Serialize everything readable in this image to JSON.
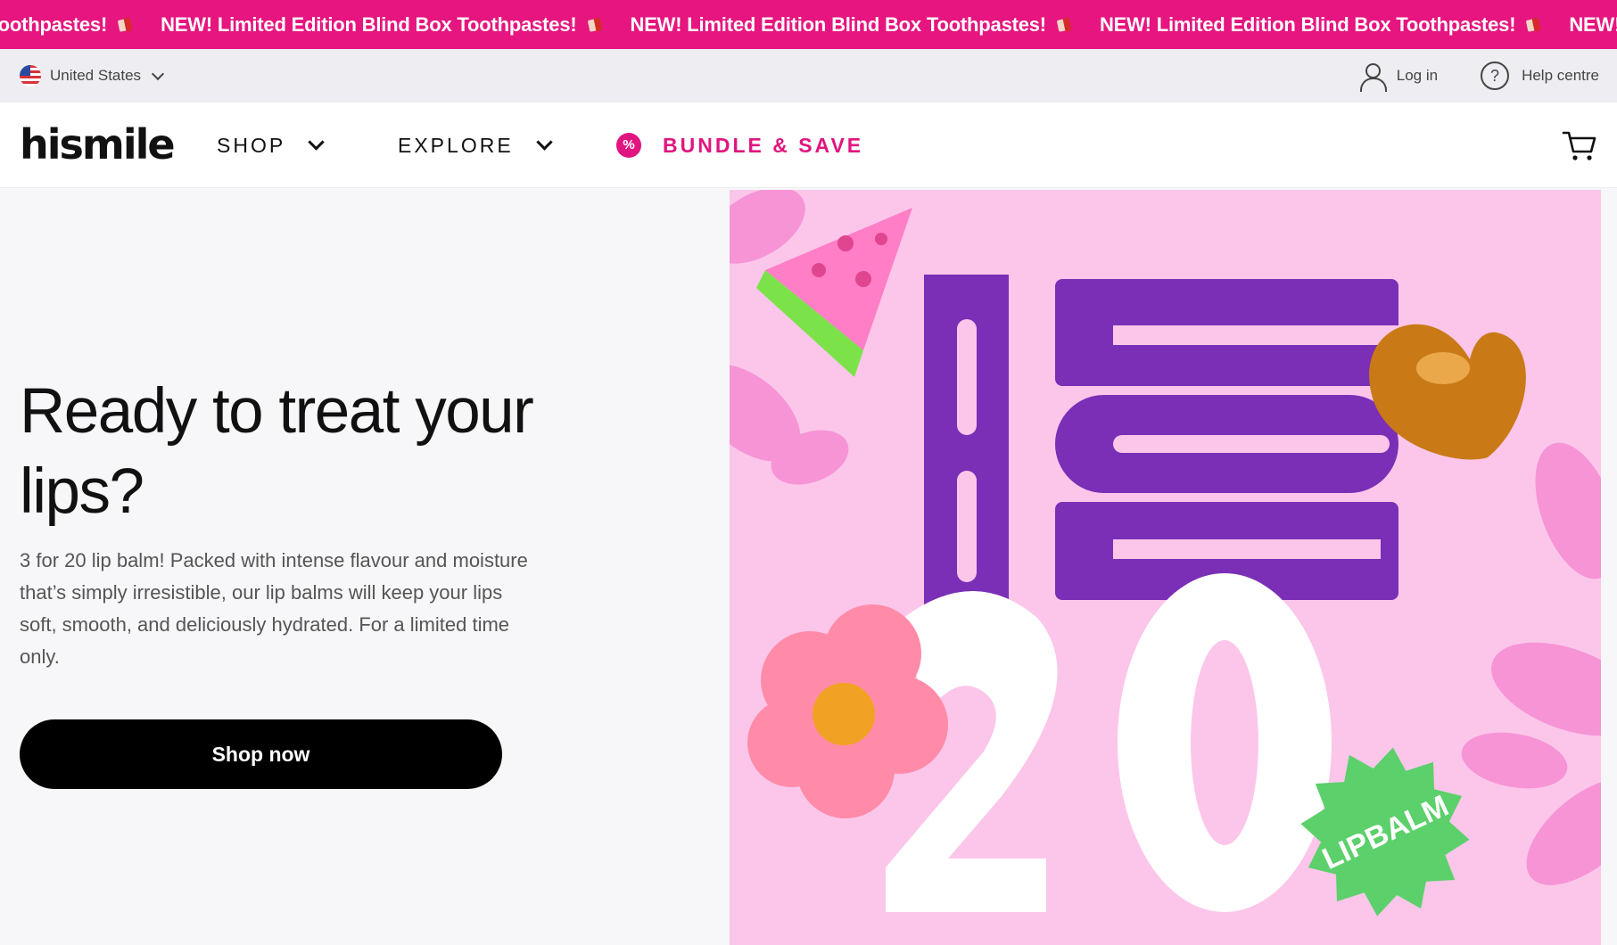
{
  "announcement": {
    "items": [
      "Toothpastes!",
      "NEW! Limited Edition Blind Box Toothpastes!",
      "NEW! Limited Edition Blind Box Toothpastes!",
      "NEW! Limited Edition Blind Box Toothpastes!",
      "NEW! Limite"
    ],
    "background": "#e6157f"
  },
  "utility": {
    "region": "United States",
    "login": "Log in",
    "help": "Help centre"
  },
  "nav": {
    "logo": "hismile",
    "shop": "SHOP",
    "explore": "EXPLORE",
    "bundle": "BUNDLE & SAVE",
    "accent": "#e0157f"
  },
  "hero": {
    "title": "Ready to treat your lips?",
    "body": "3 for 20 lip balm! Packed with intense flavour and moisture that’s simply irresistible, our lip balms will keep your lips soft, smooth, and deliciously hydrated. For a limited time only.",
    "cta": "Shop now",
    "image": {
      "big_number_top": "3",
      "word": "FOR",
      "big_number_bottom": "20",
      "badge": "LIPBALM",
      "background": "#fcc6ea",
      "purple": "#7a2fb6"
    }
  }
}
